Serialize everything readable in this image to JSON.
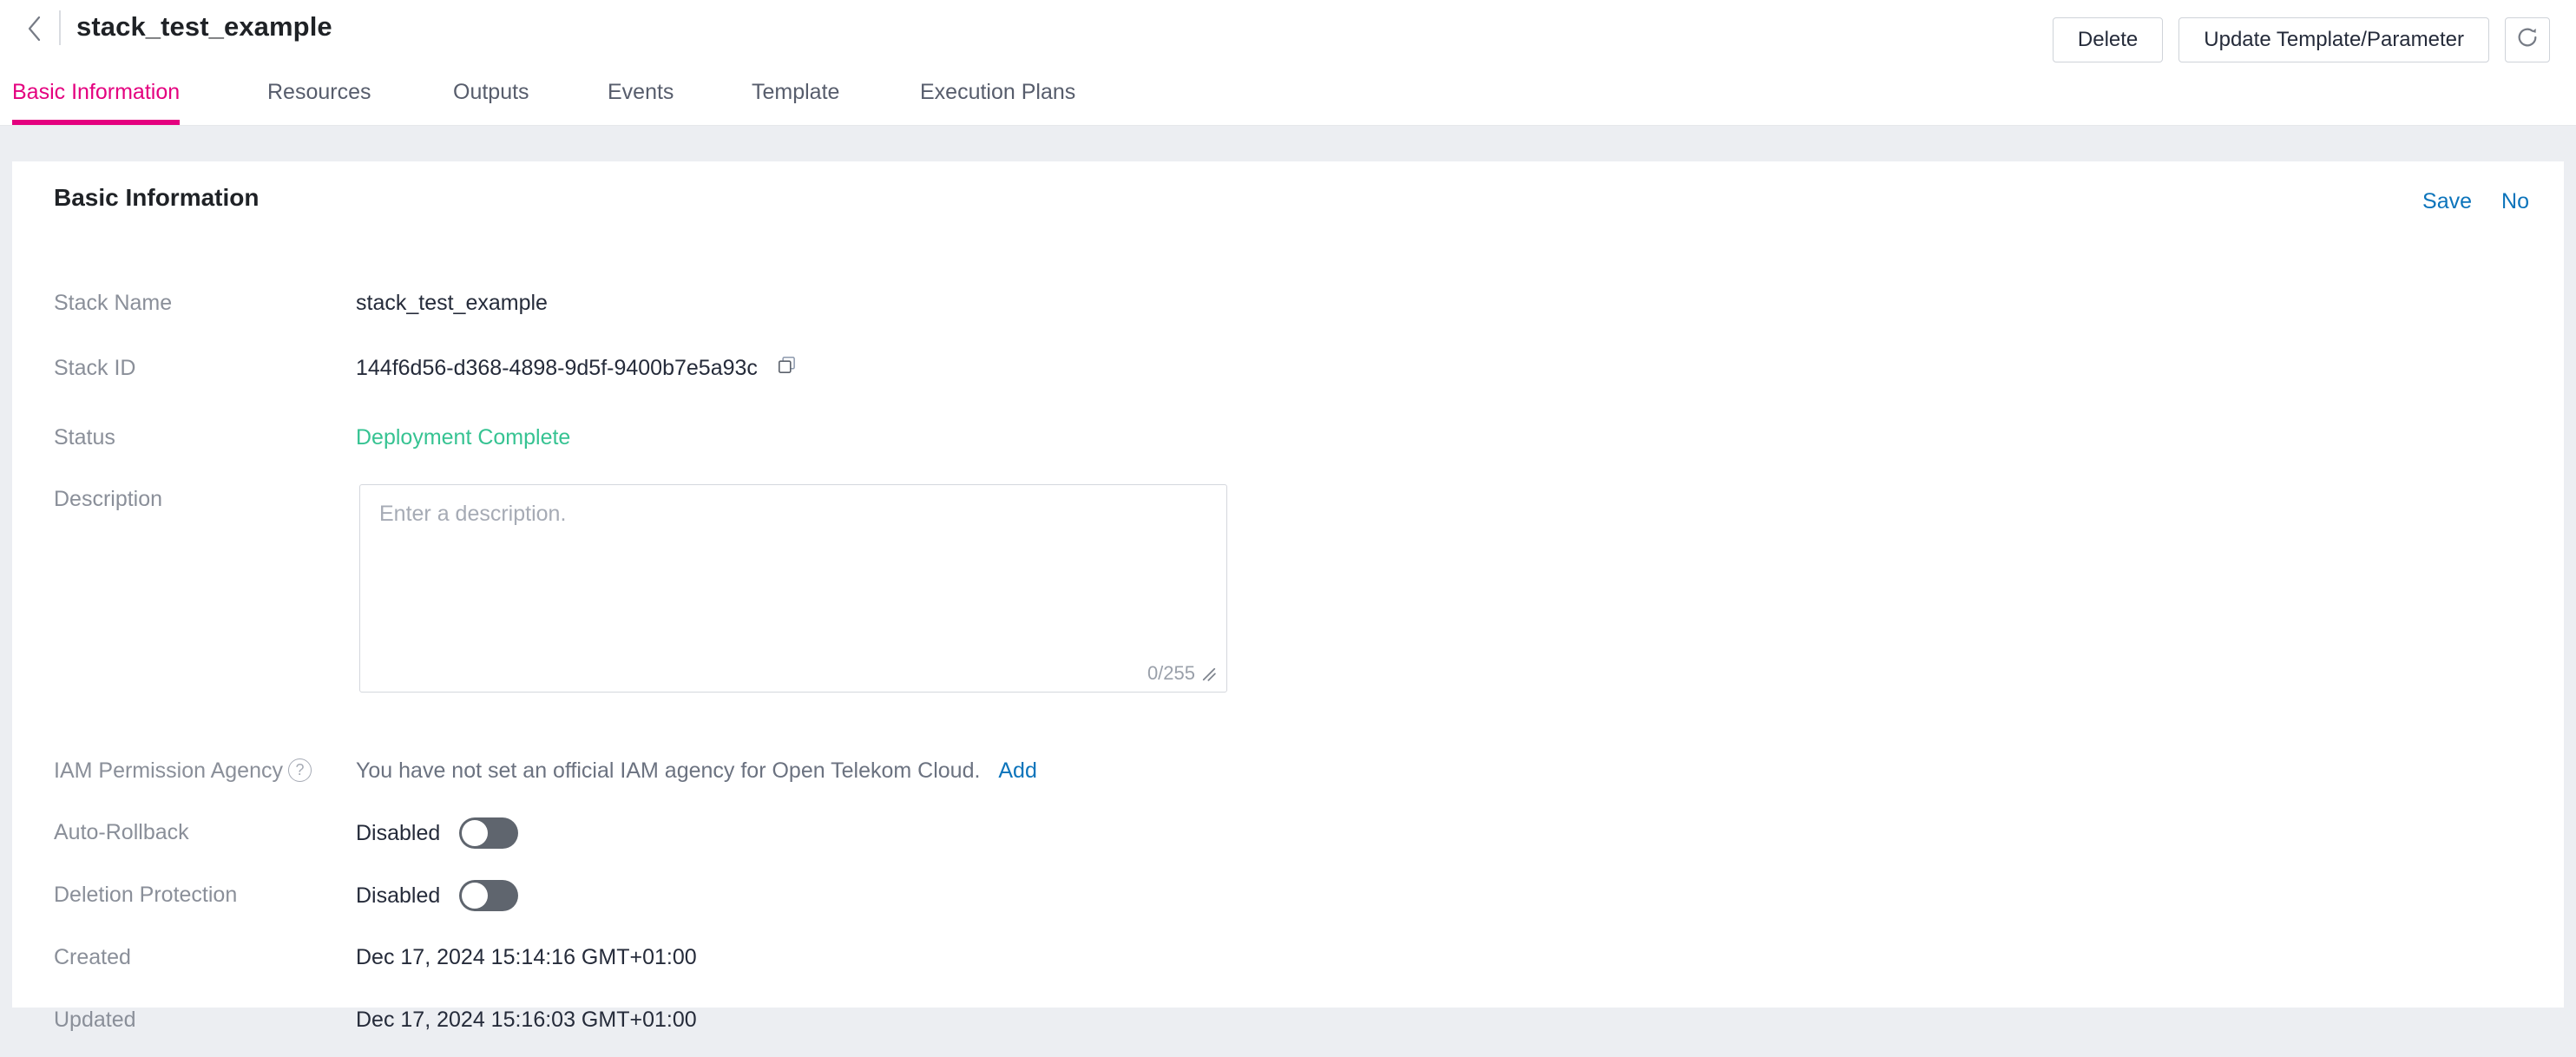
{
  "header": {
    "back_icon": "chevron-left-icon",
    "title": "stack_test_example",
    "buttons": {
      "delete": "Delete",
      "update": "Update Template/Parameter",
      "refresh_icon": "refresh-icon"
    }
  },
  "tabs": [
    {
      "label": "Basic Information",
      "active": true
    },
    {
      "label": "Resources",
      "active": false
    },
    {
      "label": "Outputs",
      "active": false
    },
    {
      "label": "Events",
      "active": false
    },
    {
      "label": "Template",
      "active": false
    },
    {
      "label": "Execution Plans",
      "active": false
    }
  ],
  "card": {
    "title": "Basic Information",
    "links": {
      "save": "Save",
      "no": "No"
    }
  },
  "fields": {
    "stack_name": {
      "label": "Stack Name",
      "value": "stack_test_example"
    },
    "stack_id": {
      "label": "Stack ID",
      "value": "144f6d56-d368-4898-9d5f-9400b7e5a93c",
      "copy_icon": "copy-icon"
    },
    "status": {
      "label": "Status",
      "value": "Deployment Complete",
      "color": "#36c392"
    },
    "description": {
      "label": "Description",
      "value": "",
      "placeholder": "Enter a description.",
      "char_count": "0/255"
    },
    "iam_permission_agency": {
      "label": "IAM Permission Agency",
      "help_icon": "question-mark-icon",
      "value": "You have not set an official IAM agency for Open Telekom Cloud.",
      "add_link": "Add"
    },
    "auto_rollback": {
      "label": "Auto-Rollback",
      "value": "Disabled",
      "enabled": false
    },
    "deletion_protection": {
      "label": "Deletion Protection",
      "value": "Disabled",
      "enabled": false
    },
    "created": {
      "label": "Created",
      "value": "Dec 17, 2024 15:14:16 GMT+01:00"
    },
    "updated": {
      "label": "Updated",
      "value": "Dec 17, 2024 15:16:03 GMT+01:00"
    }
  },
  "colors": {
    "accent": "#e4007f",
    "link": "#0c74bb",
    "success": "#36c392",
    "page_bg": "#eceef2"
  }
}
